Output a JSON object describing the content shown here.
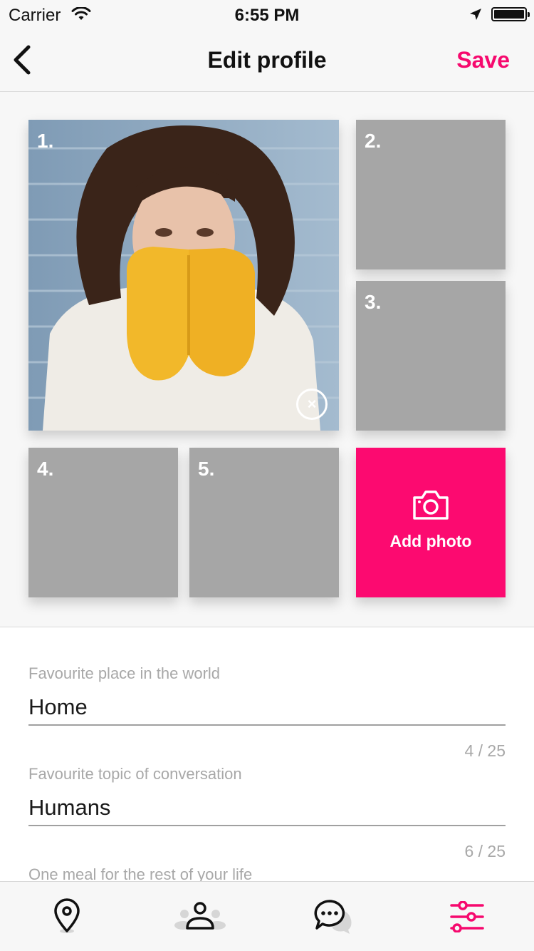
{
  "status_bar": {
    "carrier": "Carrier",
    "time": "6:55 PM"
  },
  "nav": {
    "title": "Edit profile",
    "save_label": "Save",
    "back_icon": "chevron-left-icon"
  },
  "photos": {
    "slots": [
      {
        "number": "1.",
        "filled": true
      },
      {
        "number": "2.",
        "filled": false
      },
      {
        "number": "3.",
        "filled": false
      },
      {
        "number": "4.",
        "filled": false
      },
      {
        "number": "5.",
        "filled": false
      }
    ],
    "add_photo_label": "Add photo",
    "remove_symbol": "×"
  },
  "form": {
    "fields": [
      {
        "label": "Favourite place in the world",
        "value": "Home",
        "counter": "4 / 25"
      },
      {
        "label": "Favourite topic of conversation",
        "value": "Humans",
        "counter": "6 / 25"
      },
      {
        "label": "One meal for the rest of your life",
        "value": "",
        "counter": ""
      }
    ]
  },
  "tabs": [
    {
      "name": "map-pin-icon",
      "active": false
    },
    {
      "name": "people-icon",
      "active": false
    },
    {
      "name": "chat-icon",
      "active": false
    },
    {
      "name": "settings-sliders-icon",
      "active": true
    }
  ],
  "colors": {
    "accent": "#f6096e",
    "placeholder_tile": "#a6a6a6",
    "label_gray": "#a8a8a8"
  }
}
